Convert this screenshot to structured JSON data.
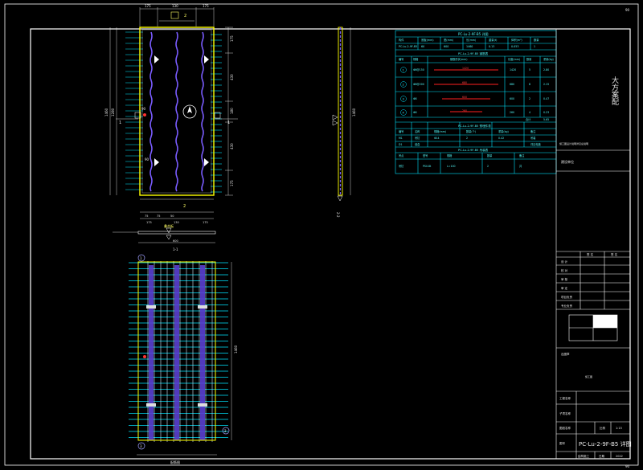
{
  "sheet": {
    "corner_mark_top": "90",
    "corner_mark_bottom": "90"
  },
  "colors": {
    "frame": "#ffffff",
    "table_line": "#00e5ff",
    "panel_edge": "#ffff00",
    "rebar": "#7a5cff",
    "tick": "#00e5ff",
    "red_rebar": "#ff2020",
    "dim_text": "#e8e8e8"
  },
  "elevation_view": {
    "section_mark_top": "2",
    "section_mark_left": "1",
    "section_mark_right": "1",
    "section_mark_bottom": "2",
    "dims_top": [
      "175",
      "130",
      "175"
    ],
    "dims_left_vertical": [
      "1460",
      "1280"
    ],
    "dims_right_vertical": [
      "175",
      "430",
      "180",
      "430",
      "175"
    ],
    "dims_bottom": [
      "75",
      "75",
      "50",
      "175",
      "130",
      "175"
    ],
    "left_label": "90",
    "mid_label": "90"
  },
  "section_1_1": {
    "label": "1-1",
    "dim_total": "600",
    "callout": "叠合板"
  },
  "side_view": {
    "dim_vertical": "1460",
    "label": "2-2"
  },
  "rebar_plan": {
    "callout_tl": "1",
    "callout_bl": "3",
    "callout_br": "2",
    "dim_right": "1460",
    "bottom_label": "配筋图"
  },
  "table_main": {
    "title": "PC-Lu-2-9F-B5 详图",
    "header": [
      "构件",
      "底板(mm)",
      "宽(mm)",
      "长(mm)",
      "重量(t)",
      "体积(m³)",
      "数量"
    ],
    "row": [
      "PC-Lu-2-9F-B5",
      "60",
      "600",
      "1460",
      "0.13",
      "0.053",
      "1"
    ]
  },
  "table_rebar": {
    "title": "PC-Lu-2-9F-B5 钢筋表",
    "header": [
      "编号",
      "规格",
      "钢筋形状(mm)",
      "长度(mm)",
      "数量",
      "重量(kg)"
    ],
    "rows": [
      {
        "no": "1",
        "spec": "Φ8@150",
        "shape": "1420",
        "len": "1420",
        "qty": "5",
        "wt": "2.80"
      },
      {
        "no": "2",
        "spec": "Φ8@200",
        "shape": "680",
        "len": "680",
        "qty": "8",
        "wt": "2.15"
      },
      {
        "no": "3",
        "spec": "Φ8",
        "shape": "600",
        "len": "600",
        "qty": "2",
        "wt": "0.47"
      },
      {
        "no": "4",
        "spec": "Φ6",
        "shape": "260",
        "len": "260",
        "qty": "4",
        "wt": "0.23"
      }
    ],
    "total_label": "合计",
    "total_value": "5.65"
  },
  "table_embed": {
    "title": "PC-Lu-2-9F-B5 预埋件表",
    "header": [
      "编号",
      "名称",
      "规格(mm)",
      "数量(个)",
      "重量(kg)",
      "备注"
    ],
    "rows": [
      [
        "M1",
        "吊钉",
        "Φ14",
        "2",
        "0.42",
        "吊装"
      ],
      [
        "D1",
        "线盒",
        "",
        "",
        "",
        "详见电施"
      ]
    ]
  },
  "table_lift": {
    "title": "PC-Lu-2-9F-B5 吊装表",
    "header": [
      "吊点",
      "型号",
      "规格",
      "数量",
      "备注"
    ],
    "row": [
      "吊钉",
      "PS0.8t",
      "L=100",
      "2",
      "共"
    ]
  },
  "title_block": {
    "company": "大方案配",
    "note_line": "施工图设计说明详见总说明",
    "project_label": "建设单位",
    "sign_header": [
      "签 名",
      "签 名"
    ],
    "sign_rows": [
      "设 计",
      "校 对",
      "审 核",
      "审 定",
      "项目负责",
      "专业负责"
    ],
    "stamp_label": "出图章",
    "stamp_note": "施工图",
    "project_name_label": "工程名称",
    "subproject_label": "子项名称",
    "drawing_name_label": "图纸名称",
    "scale_label": "比例",
    "scale_value": "1:15",
    "drawing_name": "PC-Lu-2-9F-B5 详图",
    "drawing_no_label": "图号",
    "sheet_label": "结构施工",
    "date_label": "日期",
    "date_value": "2022"
  }
}
